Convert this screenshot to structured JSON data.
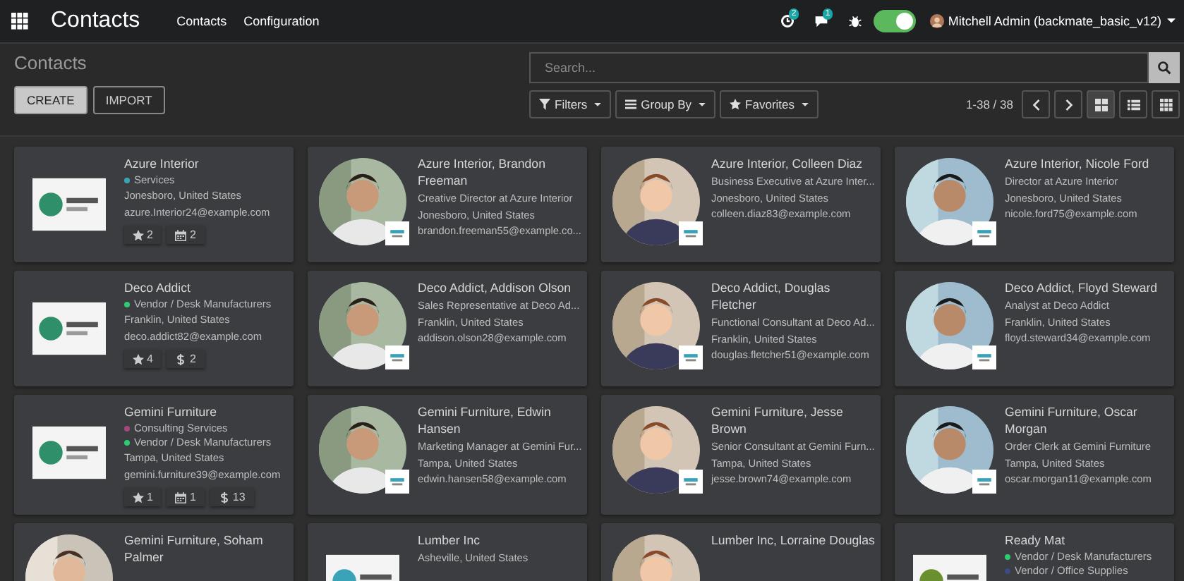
{
  "topbar": {
    "app_title": "Contacts",
    "menu": [
      "Contacts",
      "Configuration"
    ],
    "activity_badge": "2",
    "messages_badge": "1",
    "debug_mode": true,
    "user": "Mitchell Admin (backmate_basic_v12)"
  },
  "control_panel": {
    "breadcrumb": "Contacts",
    "search": {
      "placeholder": "Search..."
    },
    "buttons": [
      {
        "label": "CREATE",
        "primary": true
      },
      {
        "label": "IMPORT",
        "primary": false
      }
    ],
    "filters": [
      {
        "kind": "filter",
        "label": "Filters"
      },
      {
        "kind": "group",
        "label": "Group By"
      },
      {
        "kind": "favorite",
        "label": "Favorites"
      }
    ],
    "pager": "1-38 / 38",
    "views": [
      {
        "kind": "kanban",
        "selected": true
      },
      {
        "kind": "list",
        "selected": false
      },
      {
        "kind": "grid",
        "selected": false
      }
    ]
  },
  "cards": [
    {
      "kind": "company",
      "name": "Azure Interior",
      "tags": [
        {
          "label": "Services",
          "color": "#3ba3b8"
        }
      ],
      "location": "Jonesboro, United States",
      "email": "azure.Interior24@example.com",
      "stats": [
        {
          "kind": "star",
          "count": "2"
        },
        {
          "kind": "calendar",
          "count": "2"
        }
      ]
    },
    {
      "kind": "person",
      "company_badge": true,
      "name": "Azure Interior, Brandon Freeman",
      "job": "Creative Director at Azure Interior",
      "location": "Jonesboro, United States",
      "email": "brandon.freeman55@example.co..."
    },
    {
      "kind": "person",
      "company_badge": true,
      "name": "Azure Interior, Colleen Diaz",
      "job": "Business Executive at Azure Inter...",
      "location": "Jonesboro, United States",
      "email": "colleen.diaz83@example.com"
    },
    {
      "kind": "person",
      "company_badge": true,
      "name": "Azure Interior, Nicole Ford",
      "job": "Director at Azure Interior",
      "location": "Jonesboro, United States",
      "email": "nicole.ford75@example.com"
    },
    {
      "kind": "company",
      "name": "Deco Addict",
      "tags": [
        {
          "label": "Vendor / Desk Manufacturers",
          "color": "#2ecc71"
        }
      ],
      "location": "Franklin, United States",
      "email": "deco.addict82@example.com",
      "stats": [
        {
          "kind": "star",
          "count": "4"
        },
        {
          "kind": "dollar",
          "count": "2"
        }
      ]
    },
    {
      "kind": "person",
      "company_badge": true,
      "name": "Deco Addict, Addison Olson",
      "job": "Sales Representative at Deco Ad...",
      "location": "Franklin, United States",
      "email": "addison.olson28@example.com"
    },
    {
      "kind": "person",
      "company_badge": true,
      "name": "Deco Addict, Douglas Fletcher",
      "job": "Functional Consultant at Deco Ad...",
      "location": "Franklin, United States",
      "email": "douglas.fletcher51@example.com"
    },
    {
      "kind": "person",
      "company_badge": true,
      "name": "Deco Addict, Floyd Steward",
      "job": "Analyst at Deco Addict",
      "location": "Franklin, United States",
      "email": "floyd.steward34@example.com"
    },
    {
      "kind": "company",
      "name": "Gemini Furniture",
      "tags": [
        {
          "label": "Consulting Services",
          "color": "#a0497a"
        },
        {
          "label": "Vendor / Desk Manufacturers",
          "color": "#2ecc71"
        }
      ],
      "location": "Tampa, United States",
      "email": "gemini.furniture39@example.com",
      "stats": [
        {
          "kind": "star",
          "count": "1"
        },
        {
          "kind": "calendar",
          "count": "1"
        },
        {
          "kind": "dollar",
          "count": "13"
        }
      ]
    },
    {
      "kind": "person",
      "company_badge": true,
      "name": "Gemini Furniture, Edwin Hansen",
      "job": "Marketing Manager at Gemini Fur...",
      "location": "Tampa, United States",
      "email": "edwin.hansen58@example.com"
    },
    {
      "kind": "person",
      "company_badge": true,
      "name": "Gemini Furniture, Jesse Brown",
      "job": "Senior Consultant at Gemini Furn...",
      "location": "Tampa, United States",
      "email": "jesse.brown74@example.com"
    },
    {
      "kind": "person",
      "company_badge": true,
      "name": "Gemini Furniture, Oscar Morgan",
      "job": "Order Clerk at Gemini Furniture",
      "location": "Tampa, United States",
      "email": "oscar.morgan11@example.com"
    },
    {
      "kind": "person",
      "name": "Gemini Furniture, Soham Palmer"
    },
    {
      "kind": "company",
      "name": "Lumber Inc",
      "location": "Asheville, United States"
    },
    {
      "kind": "person",
      "name": "Lumber Inc, Lorraine Douglas"
    },
    {
      "kind": "company",
      "name": "Ready Mat",
      "tags": [
        {
          "label": "Vendor / Desk Manufacturers",
          "color": "#2ecc71"
        },
        {
          "label": "Vendor / Office Supplies",
          "color": "#3d4a80"
        }
      ]
    }
  ]
}
